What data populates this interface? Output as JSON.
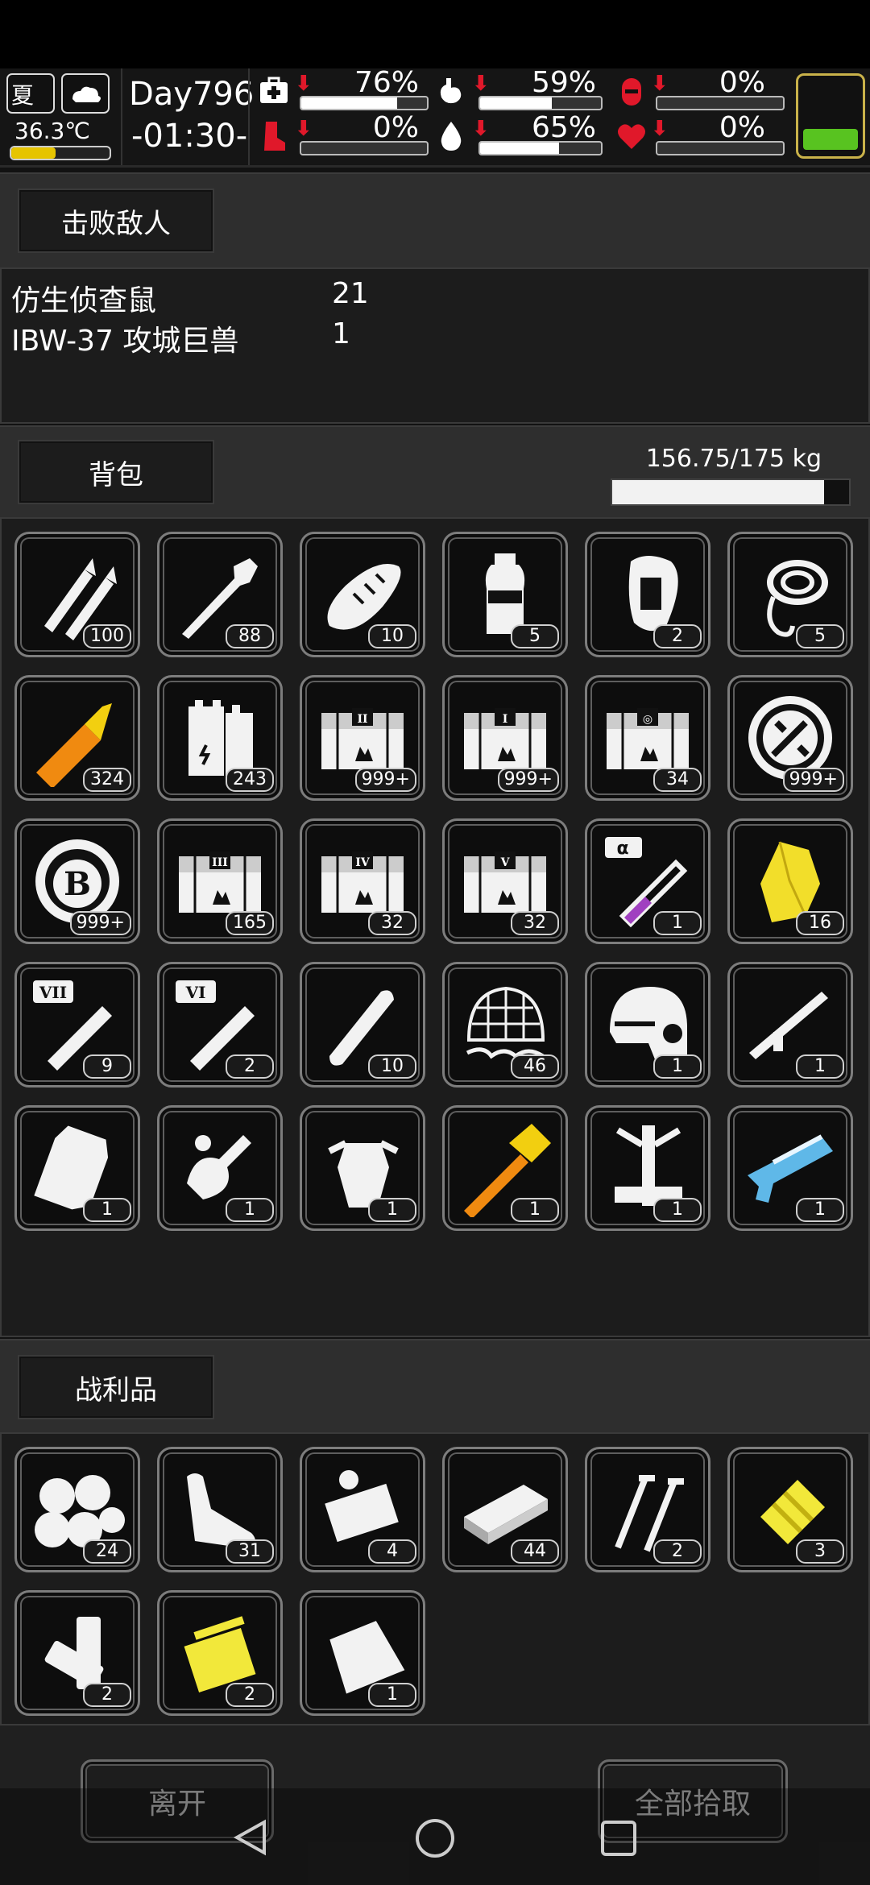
{
  "status": {
    "season": "夏",
    "temperature": "36.3℃",
    "temperature_level": 0.45,
    "day": "Day796",
    "time": "-01:30-",
    "stats": [
      {
        "icon": "medkit-icon",
        "value": "76%",
        "level": 0.76
      },
      {
        "icon": "stomach-icon",
        "value": "59%",
        "level": 0.59
      },
      {
        "icon": "bladder-icon",
        "value": "0%",
        "level": 0.0
      },
      {
        "icon": "boot-icon",
        "value": "0%",
        "level": 0.0
      },
      {
        "icon": "water-drop-icon",
        "value": "65%",
        "level": 0.65
      },
      {
        "icon": "heart-icon",
        "value": "0%",
        "level": 0.0
      }
    ],
    "battery_level": 0.3,
    "colors": {
      "alert": "#e0182a",
      "battery": "#58c320",
      "temp": "#e6c400"
    }
  },
  "defeated": {
    "title": "击败敌人",
    "enemies": [
      {
        "name": "仿生侦查鼠",
        "count": "21"
      },
      {
        "name": "IBW-37 攻城巨兽",
        "count": "1"
      }
    ]
  },
  "backpack": {
    "title": "背包",
    "weight": "156.75/175 kg",
    "weight_fraction": 0.896,
    "items": [
      {
        "icon": "bullets-icon",
        "count": "100"
      },
      {
        "icon": "rocket-icon",
        "count": "88"
      },
      {
        "icon": "bread-icon",
        "count": "10"
      },
      {
        "icon": "water-bottle-icon",
        "count": "5"
      },
      {
        "icon": "glue-bottle-icon",
        "count": "2"
      },
      {
        "icon": "rope-icon",
        "count": "5"
      },
      {
        "icon": "shell-round-icon",
        "count": "324"
      },
      {
        "icon": "battery-cells-icon",
        "count": "243"
      },
      {
        "icon": "crate-ii-icon",
        "count": "999+"
      },
      {
        "icon": "crate-i-icon",
        "count": "999+"
      },
      {
        "icon": "crate-target-icon",
        "count": "34"
      },
      {
        "icon": "tool-token-icon",
        "count": "999+"
      },
      {
        "icon": "b-coin-icon",
        "count": "999+"
      },
      {
        "icon": "crate-iii-icon",
        "count": "165"
      },
      {
        "icon": "crate-iv-icon",
        "count": "32"
      },
      {
        "icon": "crate-v-icon",
        "count": "32"
      },
      {
        "icon": "alpha-vial-icon",
        "count": "1"
      },
      {
        "icon": "yellow-crystal-icon",
        "count": "16"
      },
      {
        "icon": "vial-vii-icon",
        "count": "9"
      },
      {
        "icon": "vial-vi-icon",
        "count": "2"
      },
      {
        "icon": "bandage-roll-icon",
        "count": "10"
      },
      {
        "icon": "wire-mesh-icon",
        "count": "46"
      },
      {
        "icon": "helmet-icon",
        "count": "1"
      },
      {
        "icon": "launcher-icon",
        "count": "1"
      },
      {
        "icon": "armor-plate-icon",
        "count": "1"
      },
      {
        "icon": "mech-arm-icon",
        "count": "1"
      },
      {
        "icon": "power-armor-icon",
        "count": "1"
      },
      {
        "icon": "golden-hammer-icon",
        "count": "1"
      },
      {
        "icon": "robot-frame-icon",
        "count": "1"
      },
      {
        "icon": "plasma-rifle-icon",
        "count": "1"
      }
    ]
  },
  "loot": {
    "title": "战利品",
    "items": [
      {
        "icon": "cotton-balls-icon",
        "count": "24"
      },
      {
        "icon": "scrap-pipe-icon",
        "count": "31"
      },
      {
        "icon": "machine-parts-icon",
        "count": "4"
      },
      {
        "icon": "metal-plate-icon",
        "count": "44"
      },
      {
        "icon": "nails-icon",
        "count": "2"
      },
      {
        "icon": "yellow-spring-icon",
        "count": "3"
      },
      {
        "icon": "aa-batteries-icon",
        "count": "2"
      },
      {
        "icon": "gold-parts-icon",
        "count": "2"
      },
      {
        "icon": "plastic-bag-icon",
        "count": "1"
      }
    ]
  },
  "actions": {
    "leave": "离开",
    "take_all": "全部拾取"
  },
  "nav": [
    "back-nav-icon",
    "home-nav-icon",
    "recents-nav-icon"
  ]
}
